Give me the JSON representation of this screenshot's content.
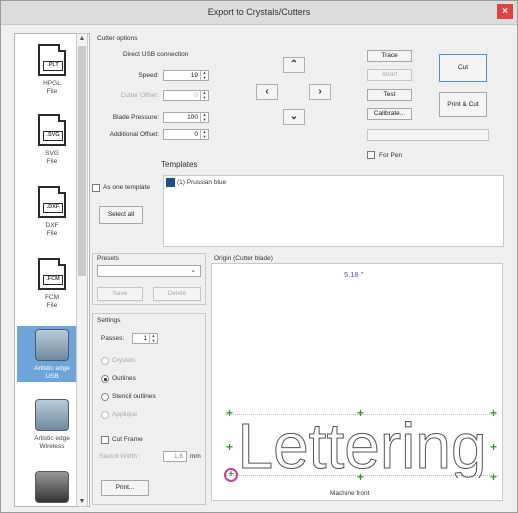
{
  "window": {
    "title": "Export to Crystals/Cutters",
    "close": "×"
  },
  "sidebar": {
    "items": [
      {
        "badge": ".PLT",
        "label1": "HPGL",
        "label2": "File"
      },
      {
        "badge": ".SVG",
        "label1": "SVG",
        "label2": "File"
      },
      {
        "badge": ".DXF",
        "label1": "DXF",
        "label2": "File"
      },
      {
        "badge": ".FCM",
        "label1": "FCM",
        "label2": "File"
      },
      {
        "label1": "Artistic edge",
        "label2": "USB"
      },
      {
        "label1": "Artistic edge",
        "label2": "Wireless"
      }
    ]
  },
  "cutter": {
    "section": "Cutter options",
    "direct_usb": "Direct USB connection",
    "speed_label": "Speed:",
    "speed": "19",
    "offset_label": "Cutter Offset:",
    "offset": "0",
    "pressure_label": "Blade Pressure:",
    "pressure": "100",
    "add_offset_label": "Additional Offset:",
    "add_offset": "0",
    "arrows": {
      "up": "⌃",
      "left": "‹",
      "right": "›",
      "down": "⌄"
    }
  },
  "actions": {
    "trace": "Trace",
    "abort": "Abort",
    "test": "Test",
    "calibrate": "Calibrate...",
    "cut": "Cut",
    "print_cut": "Print & Cut",
    "for_pen": "For Pen"
  },
  "templates": {
    "label": "Templates",
    "as_one": "As one template",
    "select_all": "Select all",
    "items": [
      {
        "name": "(1) Prussian blue",
        "color": "#1f4e8c"
      }
    ]
  },
  "presets": {
    "label": "Presets",
    "save": "Save",
    "delete": "Delete"
  },
  "settings": {
    "label": "Settings",
    "passes_label": "Passes:",
    "passes": "1",
    "options": [
      "Crystals",
      "Outlines",
      "Stencil outlines",
      "Applique"
    ],
    "selected": "Outlines",
    "cut_frame": "Cut Frame",
    "stencil_width_label": "Stencil Width :",
    "stencil_width": "1.6",
    "stencil_unit": "mm",
    "print": "Print..."
  },
  "preview": {
    "origin_label": "Origin (Cutter blade)",
    "dimension": "5.18 \"",
    "text": "Lettering",
    "footer": "Machine front"
  }
}
